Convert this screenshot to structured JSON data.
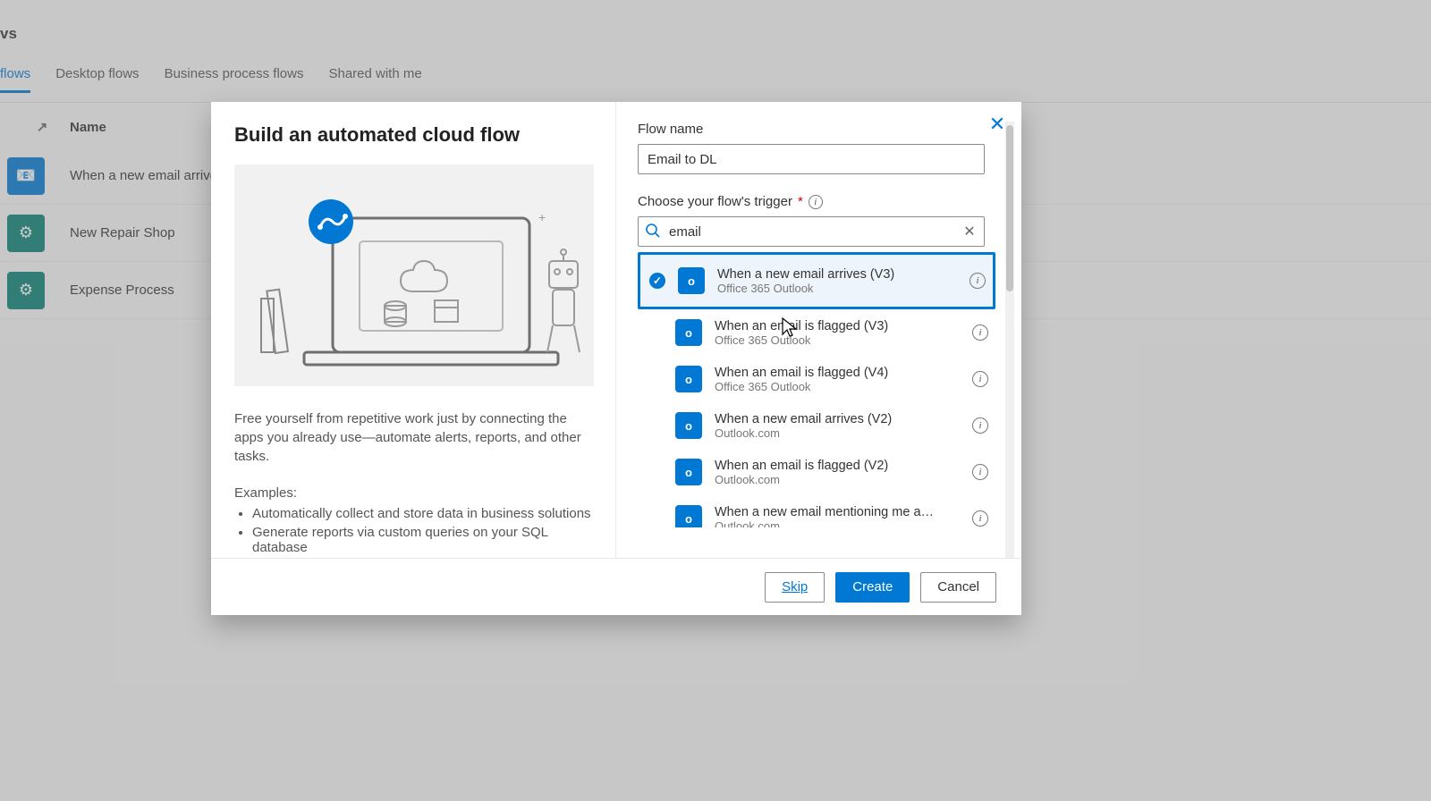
{
  "bg": {
    "page_title": "vs",
    "tabs": [
      "flows",
      "Desktop flows",
      "Business process flows",
      "Shared with me"
    ],
    "active_tab_index": 0,
    "name_col": "Name",
    "rows": [
      {
        "name": "When a new email arrives",
        "color": "blue",
        "glyph": "📧"
      },
      {
        "name": "New Repair Shop",
        "color": "teal",
        "glyph": "⚙"
      },
      {
        "name": "Expense Process",
        "color": "teal",
        "glyph": "⚙"
      }
    ]
  },
  "modal": {
    "title": "Build an automated cloud flow",
    "desc": "Free yourself from repetitive work just by connecting the apps you already use—automate alerts, reports, and other tasks.",
    "examples_label": "Examples:",
    "bullets": [
      "Automatically collect and store data in business solutions",
      "Generate reports via custom queries on your SQL database"
    ],
    "flow_name_label": "Flow name",
    "flow_name_value": "Email to DL",
    "trigger_label": "Choose your flow's trigger",
    "search_value": "email",
    "triggers": [
      {
        "title": "When a new email arrives (V3)",
        "source": "Office 365 Outlook",
        "selected": true
      },
      {
        "title": "When an email is flagged (V3)",
        "source": "Office 365 Outlook",
        "selected": false
      },
      {
        "title": "When an email is flagged (V4)",
        "source": "Office 365 Outlook",
        "selected": false
      },
      {
        "title": "When a new email arrives (V2)",
        "source": "Outlook.com",
        "selected": false
      },
      {
        "title": "When an email is flagged (V2)",
        "source": "Outlook.com",
        "selected": false
      },
      {
        "title": "When a new email mentioning me a…",
        "source": "Outlook.com",
        "selected": false
      }
    ],
    "footer": {
      "skip": "Skip",
      "create": "Create",
      "cancel": "Cancel"
    }
  }
}
